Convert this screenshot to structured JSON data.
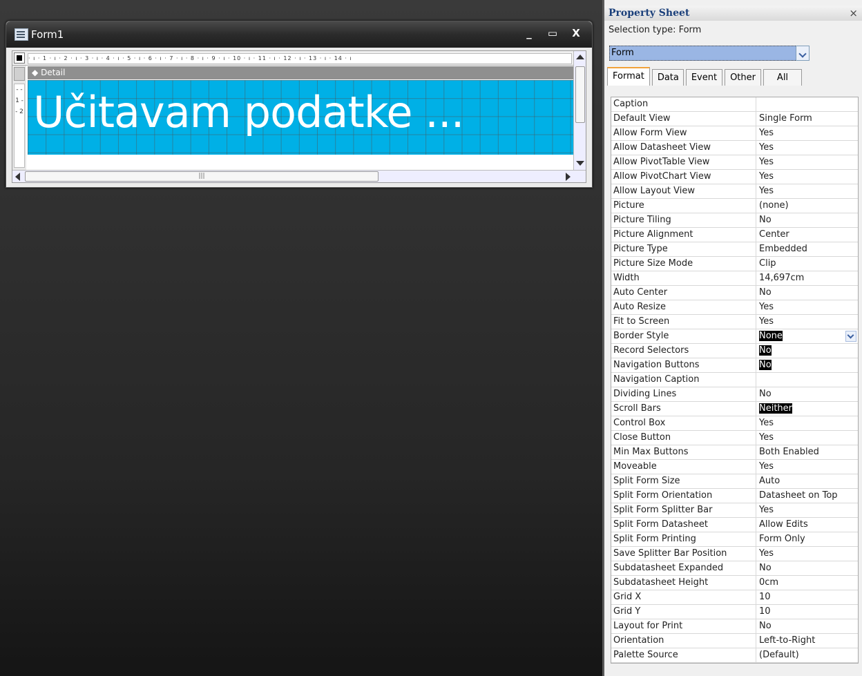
{
  "form_window": {
    "title": "Form1",
    "minimize": "_",
    "maximize": "▭",
    "close": "X",
    "ruler_text": "· ı · 1 · ı · 2 · ı · 3 · ı · 4 · ı · 5 · ı · 6 · ı · 7 · ı · 8 · ı · 9 · ı · 10 · ı · 11 · ı · 12 · ı · 13 · ı · 14 · ı",
    "vruler_text": "- - 1 - - 2",
    "section_label": "Detail",
    "section_arrow": "◆",
    "label_text": "Učitavam podatke ...",
    "label_bg_color": "#00b0e6",
    "hscroll_grip": "|||"
  },
  "property_sheet": {
    "title": "Property Sheet",
    "close": "×",
    "selection_type": "Selection type:  Form",
    "selected_object": "Form",
    "tabs": [
      "Format",
      "Data",
      "Event",
      "Other",
      "All"
    ],
    "active_tab": "Format",
    "highlight_color": "#000000",
    "properties": [
      {
        "name": "Caption",
        "value": ""
      },
      {
        "name": "Default View",
        "value": "Single Form"
      },
      {
        "name": "Allow Form View",
        "value": "Yes"
      },
      {
        "name": "Allow Datasheet View",
        "value": "Yes"
      },
      {
        "name": "Allow PivotTable View",
        "value": "Yes"
      },
      {
        "name": "Allow PivotChart View",
        "value": "Yes"
      },
      {
        "name": "Allow Layout View",
        "value": "Yes"
      },
      {
        "name": "Picture",
        "value": "(none)"
      },
      {
        "name": "Picture Tiling",
        "value": "No"
      },
      {
        "name": "Picture Alignment",
        "value": "Center"
      },
      {
        "name": "Picture Type",
        "value": "Embedded"
      },
      {
        "name": "Picture Size Mode",
        "value": "Clip"
      },
      {
        "name": "Width",
        "value": "14,697cm"
      },
      {
        "name": "Auto Center",
        "value": "No"
      },
      {
        "name": "Auto Resize",
        "value": "Yes"
      },
      {
        "name": "Fit to Screen",
        "value": "Yes"
      },
      {
        "name": "Border Style",
        "value": "None"
      },
      {
        "name": "Record Selectors",
        "value": "No"
      },
      {
        "name": "Navigation Buttons",
        "value": "No"
      },
      {
        "name": "Navigation Caption",
        "value": ""
      },
      {
        "name": "Dividing Lines",
        "value": "No"
      },
      {
        "name": "Scroll Bars",
        "value": "Neither"
      },
      {
        "name": "Control Box",
        "value": "Yes"
      },
      {
        "name": "Close Button",
        "value": "Yes"
      },
      {
        "name": "Min Max Buttons",
        "value": "Both Enabled"
      },
      {
        "name": "Moveable",
        "value": "Yes"
      },
      {
        "name": "Split Form Size",
        "value": "Auto"
      },
      {
        "name": "Split Form Orientation",
        "value": "Datasheet on Top"
      },
      {
        "name": "Split Form Splitter Bar",
        "value": "Yes"
      },
      {
        "name": "Split Form Datasheet",
        "value": "Allow Edits"
      },
      {
        "name": "Split Form Printing",
        "value": "Form Only"
      },
      {
        "name": "Save Splitter Bar Position",
        "value": "Yes"
      },
      {
        "name": "Subdatasheet Expanded",
        "value": "No"
      },
      {
        "name": "Subdatasheet Height",
        "value": "0cm"
      },
      {
        "name": "Grid X",
        "value": "10"
      },
      {
        "name": "Grid Y",
        "value": "10"
      },
      {
        "name": "Layout for Print",
        "value": "No"
      },
      {
        "name": "Orientation",
        "value": "Left-to-Right"
      },
      {
        "name": "Palette Source",
        "value": "(Default)"
      }
    ],
    "highlighted_rows": [
      "Border Style",
      "Record Selectors",
      "Navigation Buttons",
      "Scroll Bars"
    ],
    "dropdown_row": "Border Style"
  }
}
